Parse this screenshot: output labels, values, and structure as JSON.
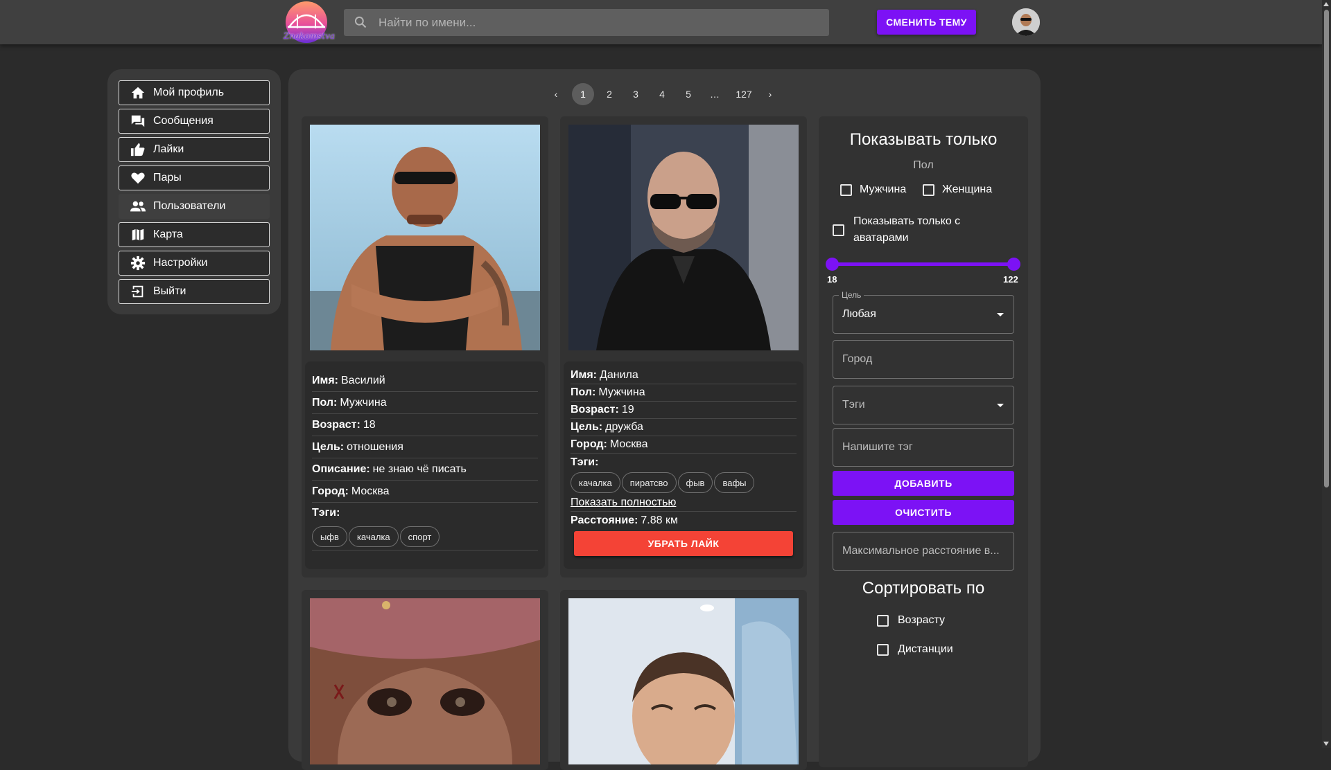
{
  "header": {
    "logo_text": "Znakomstva",
    "search_placeholder": "Найти по имени...",
    "theme_button": "СМЕНИТЬ ТЕМУ"
  },
  "sidebar": {
    "items": [
      {
        "label": "Мой профиль",
        "icon": "home-icon"
      },
      {
        "label": "Сообщения",
        "icon": "chat-icon"
      },
      {
        "label": "Лайки",
        "icon": "thumb-up-icon"
      },
      {
        "label": "Пары",
        "icon": "heart-icon"
      },
      {
        "label": "Пользователи",
        "icon": "users-icon"
      },
      {
        "label": "Карта",
        "icon": "map-icon"
      },
      {
        "label": "Настройки",
        "icon": "gear-icon"
      },
      {
        "label": "Выйти",
        "icon": "logout-icon"
      }
    ]
  },
  "pagination": {
    "prev": "‹",
    "pages": [
      "1",
      "2",
      "3",
      "4",
      "5",
      "…",
      "127"
    ],
    "current": "1",
    "next": "›"
  },
  "cards": [
    {
      "name_label": "Имя:",
      "name": "Василий",
      "gender_label": "Пол:",
      "gender": "Мужчина",
      "age_label": "Возраст:",
      "age": "18",
      "goal_label": "Цель:",
      "goal": "отношения",
      "desc_label": "Описание:",
      "desc": "не знаю чё писать",
      "city_label": "Город:",
      "city": "Москва",
      "tags_label": "Тэги:",
      "tags": [
        "ыфв",
        "качалка",
        "спорт"
      ]
    },
    {
      "name_label": "Имя:",
      "name": "Данила",
      "gender_label": "Пол:",
      "gender": "Мужчина",
      "age_label": "Возраст:",
      "age": "19",
      "goal_label": "Цель:",
      "goal": "дружба",
      "city_label": "Город:",
      "city": "Москва",
      "tags_label": "Тэги:",
      "tags": [
        "качалка",
        "пиратсво",
        "фыв",
        "вафы"
      ],
      "show_full": "Показать полностью",
      "distance_label": "Расстояние:",
      "distance": "7.88 км",
      "unlike_button": "УБРАТЬ ЛАЙК"
    }
  ],
  "filters": {
    "title": "Показывать только",
    "gender_heading": "Пол",
    "male": "Мужчина",
    "female": "Женщина",
    "only_avatars": "Показывать только с аватарами",
    "age_min": "18",
    "age_max": "122",
    "goal_legend": "Цель",
    "goal_value": "Любая",
    "city_placeholder": "Город",
    "tags_placeholder": "Тэги",
    "tag_input_placeholder": "Напишите тэг",
    "add_button": "ДОБАВИТЬ",
    "clear_button": "ОЧИСТИТЬ",
    "max_distance_placeholder": "Максимальное расстояние в...",
    "sort_title": "Сортировать по",
    "sort_age": "Возрасту",
    "sort_distance": "Дистанции"
  },
  "colors": {
    "accent": "#7c12f5",
    "danger": "#f44336",
    "topbar": "#404040",
    "background": "#2b2b2b",
    "panel": "#3a3a3a"
  }
}
